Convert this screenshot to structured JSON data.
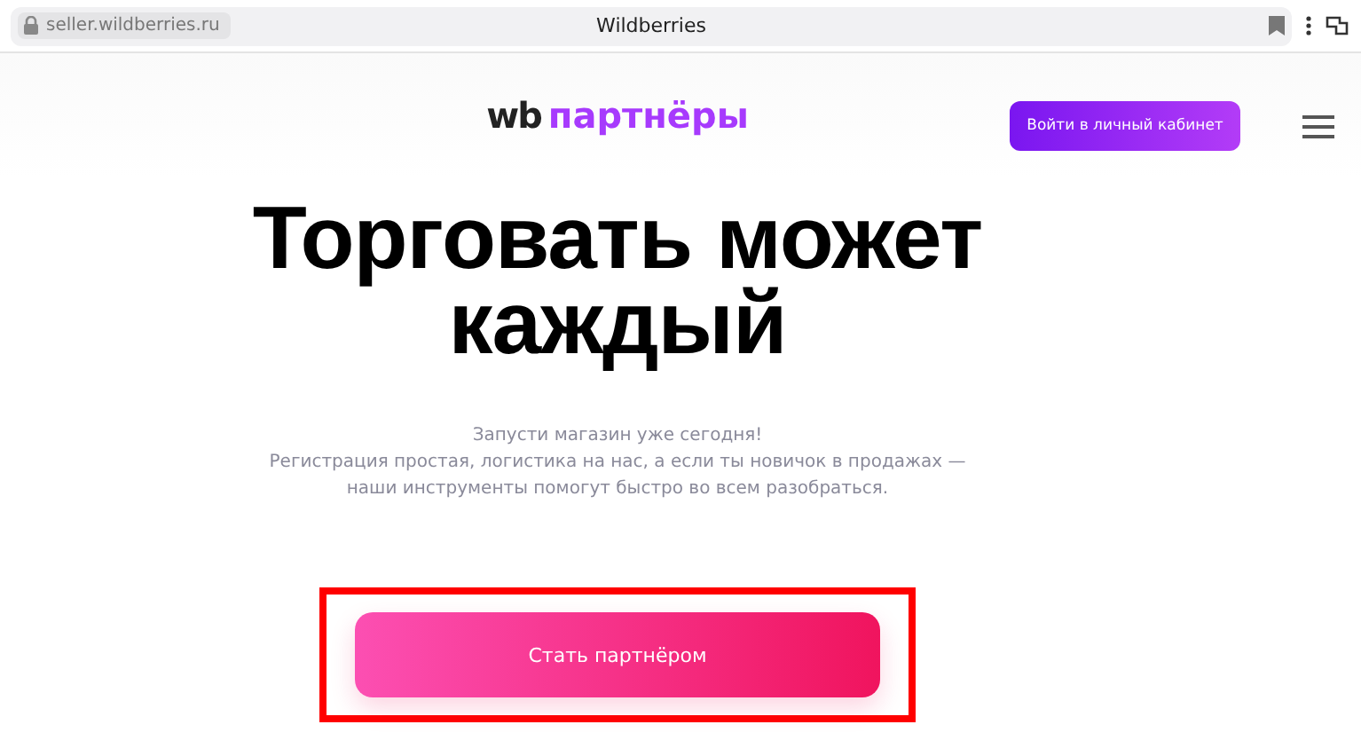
{
  "browser": {
    "url": "seller.wildberries.ru",
    "title": "Wildberries"
  },
  "header": {
    "logo_prefix": "wb",
    "logo_word": "партнёры",
    "login_button": "Войти в личный кабинет"
  },
  "hero": {
    "headline_lines": [
      "Торговать может",
      "каждый"
    ],
    "subtitle_lines": [
      "Запусти магазин уже сегодня!",
      "Регистрация простая, логистика на нас, а если ты новичок в продажах —",
      "наши инструменты помогут быстро во всем разобраться."
    ],
    "cta_button": "Стать партнёром",
    "cta_highlighted": true
  }
}
